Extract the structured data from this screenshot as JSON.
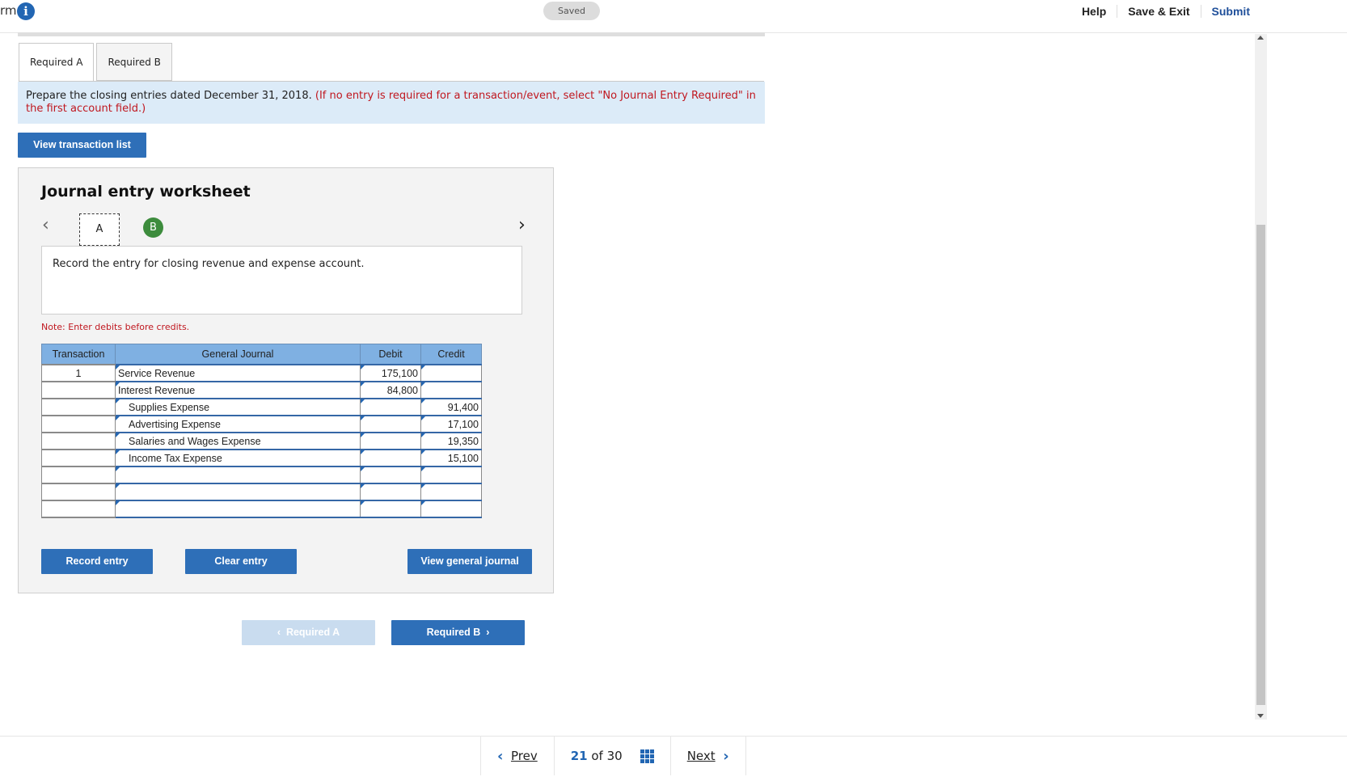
{
  "topbar": {
    "title_fragment": "rm",
    "saved_label": "Saved",
    "help_label": "Help",
    "save_exit_label": "Save & Exit",
    "submit_label": "Submit"
  },
  "tabs": [
    {
      "label": "Required A"
    },
    {
      "label": "Required B"
    }
  ],
  "instructions": {
    "main": "Prepare the closing entries dated December 31, 2018.",
    "red": "(If no entry is required for a transaction/event, select \"No Journal Entry Required\" in the first account field.)"
  },
  "view_transaction_list_label": "View transaction list",
  "worksheet": {
    "title": "Journal entry worksheet",
    "step_a": "A",
    "step_b": "B",
    "description": "Record the entry for closing revenue and expense account.",
    "note": "Note: Enter debits before credits.",
    "headers": [
      "Transaction",
      "General Journal",
      "Debit",
      "Credit"
    ],
    "rows": [
      {
        "transaction": "1",
        "account": "Service Revenue",
        "debit": "175,100",
        "credit": ""
      },
      {
        "transaction": "",
        "account": "Interest Revenue",
        "debit": "84,800",
        "credit": ""
      },
      {
        "transaction": "",
        "account": "Supplies Expense",
        "debit": "",
        "credit": "91,400"
      },
      {
        "transaction": "",
        "account": "Advertising Expense",
        "debit": "",
        "credit": "17,100"
      },
      {
        "transaction": "",
        "account": "Salaries and Wages Expense",
        "debit": "",
        "credit": "19,350"
      },
      {
        "transaction": "",
        "account": "Income Tax Expense",
        "debit": "",
        "credit": "15,100"
      },
      {
        "transaction": "",
        "account": "",
        "debit": "",
        "credit": ""
      },
      {
        "transaction": "",
        "account": "",
        "debit": "",
        "credit": ""
      },
      {
        "transaction": "",
        "account": "",
        "debit": "",
        "credit": ""
      }
    ],
    "record_entry_label": "Record entry",
    "clear_entry_label": "Clear entry",
    "view_general_journal_label": "View general journal"
  },
  "nav": {
    "prev_required_label": "Required A",
    "next_required_label": "Required B"
  },
  "pager": {
    "prev_label": "Prev",
    "current": "21",
    "of_label": "of",
    "total": "30",
    "next_label": "Next"
  },
  "colors": {
    "primary_button": "#2e6fb8",
    "header_blue": "#7fb0e2",
    "instruction_bg": "#dcebf8",
    "alert_red": "#c0171f",
    "step_green": "#3d8c3d"
  }
}
